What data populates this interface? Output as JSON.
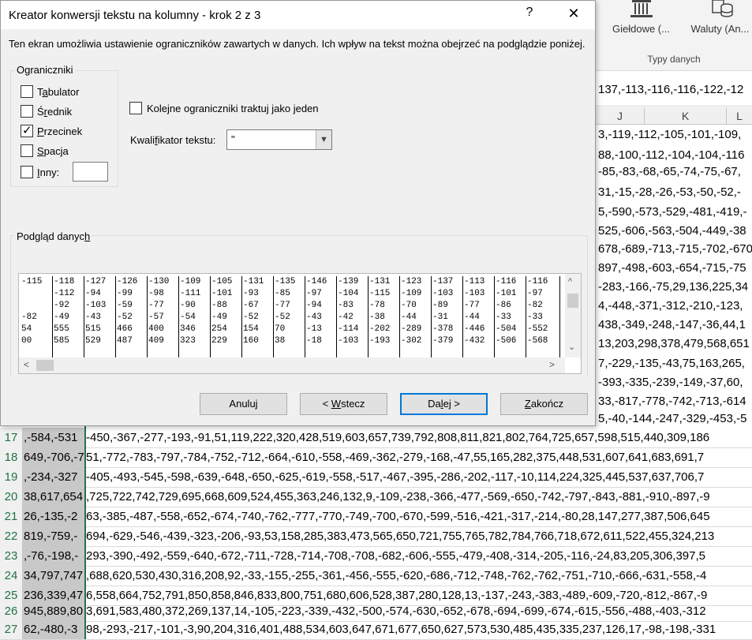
{
  "ribbon": {
    "buttons": [
      {
        "label": "Giełdowe (...",
        "icon": "bank-icon"
      },
      {
        "label": "Waluty (An...",
        "icon": "currency-icon"
      }
    ],
    "group_label": "Typy danych"
  },
  "formula_bar": {
    "text": "137,-113,-116,-116,-122,-12"
  },
  "columns": [
    "J",
    "K",
    "L"
  ],
  "right_rows": [
    "3,-119,-112,-105,-101,-109,",
    "88,-100,-112,-104,-104,-116",
    "-85,-83,-68,-65,-74,-75,-67,",
    "31,-15,-28,-26,-53,-50,-52,-",
    "5,-590,-573,-529,-481,-419,-",
    "525,-606,-563,-504,-449,-38",
    "678,-689,-713,-715,-702,-670",
    "897,-498,-603,-654,-715,-75",
    "-283,-166,-75,29,136,225,34",
    "4,-448,-371,-312,-210,-123,",
    "438,-349,-248,-147,-36,44,1",
    "13,203,298,378,479,568,651",
    "7,-229,-135,-43,75,163,265,",
    "-393,-335,-239,-149,-37,60,",
    "33,-817,-778,-742,-713,-614",
    "5,-40,-144,-247,-329,-453,-5"
  ],
  "rows": [
    {
      "num": "17",
      "a": ",-584,-531",
      "text": "-450,-367,-277,-193,-91,51,119,222,320,428,519,603,657,739,792,808,811,821,802,764,725,657,598,515,440,309,186"
    },
    {
      "num": "18",
      "a": "649,-706,-7",
      "text": "51,-772,-783,-797,-784,-752,-712,-664,-610,-558,-469,-362,-279,-168,-47,55,165,282,375,448,531,607,641,683,691,7"
    },
    {
      "num": "19",
      "a": ",-234,-327",
      "text": "-405,-493,-545,-598,-639,-648,-650,-625,-619,-558,-517,-467,-395,-286,-202,-117,-10,114,224,325,445,537,637,706,7"
    },
    {
      "num": "20",
      "a": "38,617,654",
      "text": ",725,722,742,729,695,668,609,524,455,363,246,132,9,-109,-238,-366,-477,-569,-650,-742,-797,-843,-881,-910,-897,-9"
    },
    {
      "num": "21",
      "a": "26,-135,-2",
      "text": "63,-385,-487,-558,-652,-674,-740,-762,-777,-770,-749,-700,-670,-599,-516,-421,-317,-214,-80,28,147,277,387,506,645"
    },
    {
      "num": "22",
      "a": "819,-759,-",
      "text": "694,-629,-546,-439,-323,-206,-93,53,158,285,383,473,565,650,721,755,765,782,784,766,718,672,611,522,455,324,213"
    },
    {
      "num": "23",
      "a": ",-76,-198,-",
      "text": "293,-390,-492,-559,-640,-672,-711,-728,-714,-708,-708,-682,-606,-555,-479,-408,-314,-205,-116,-24,83,205,306,397,5"
    },
    {
      "num": "24",
      "a": "34,797,747",
      "text": ",688,620,530,430,316,208,92,-33,-155,-255,-361,-456,-555,-620,-686,-712,-748,-762,-762,-751,-710,-666,-631,-558,-4"
    },
    {
      "num": "25",
      "a": "236,339,47",
      "text": "6,558,664,752,791,850,858,846,833,800,751,680,606,528,387,280,128,13,-137,-243,-383,-489,-609,-720,-812,-867,-9"
    },
    {
      "num": "26",
      "a": "945,889,80",
      "text": "3,691,583,480,372,269,137,14,-105,-223,-339,-432,-500,-574,-630,-652,-678,-694,-699,-674,-615,-556,-488,-403,-312"
    },
    {
      "num": "27",
      "a": "62,-480,-3",
      "text": "98,-293,-217,-101,-3,90,204,316,401,488,534,603,647,671,677,650,627,573,530,485,435,335,237,126,17,-98,-198,-331"
    }
  ],
  "dialog": {
    "title": "Kreator konwersji tekstu na kolumny - krok 2 z 3",
    "help": "?",
    "close": "✕",
    "description": "Ten ekran umożliwia ustawienie ograniczników zawartych w danych. Ich wpływ na tekst można obejrzeć na podglądzie poniżej.",
    "delimiters_title": "Ograniczniki",
    "delimiters": [
      {
        "pre": "T",
        "u": "a",
        "post": "bulator",
        "checked": false
      },
      {
        "pre": "Ś",
        "u": "r",
        "post": "ednik",
        "checked": false
      },
      {
        "pre": "",
        "u": "P",
        "post": "rzecinek",
        "checked": true
      },
      {
        "pre": "",
        "u": "S",
        "post": "pacja",
        "checked": false
      },
      {
        "pre": "",
        "u": "I",
        "post": "nny:",
        "checked": false
      }
    ],
    "other_value": "",
    "consecutive": {
      "pre": "Kolejne o",
      "u": "g",
      "post": "raniczniki traktuj jako jeden",
      "checked": false
    },
    "qualifier": {
      "label_pre": "Kwali",
      "label_u": "f",
      "label_post": "ikator tekstu:",
      "value": "\""
    },
    "preview_title_pre": "Podgląd danyc",
    "preview_title_u": "h",
    "preview_columns": [
      "-115\n\n\n-82\n54\n00",
      "-118\n-112\n-92\n-49\n555\n585",
      "-127\n-94\n-103\n-43\n515\n529",
      "-126\n-99\n-59\n-52\n466\n487",
      "-130\n-98\n-77\n-57\n400\n409",
      "-109\n-111\n-90\n-54\n346\n323",
      "-105\n-101\n-88\n-49\n254\n229",
      "-131\n-93\n-67\n-52\n154\n160",
      "-135\n-85\n-77\n-52\n70\n38",
      "-146\n-97\n-94\n-43\n-13\n-18",
      "-139\n-104\n-83\n-42\n-114\n-103",
      "-131\n-115\n-78\n-38\n-202\n-193",
      "-123\n-109\n-70\n-44\n-289\n-302",
      "-137\n-103\n-89\n-31\n-378\n-379",
      "-113\n-103\n-77\n-44\n-446\n-432",
      "-116\n-101\n-86\n-33\n-504\n-506",
      "-116\n-97\n-82\n-33\n-552\n-568"
    ],
    "buttons": {
      "cancel": "Anuluj",
      "back_pre": "< ",
      "back_u": "W",
      "back_post": "stecz",
      "next_pre": "Da",
      "next_u": "l",
      "next_post": "ej >",
      "finish_pre": "",
      "finish_u": "Z",
      "finish_post": "akończ"
    }
  },
  "colors": {
    "accent_green": "#217346",
    "focus_blue": "#0078d7"
  }
}
